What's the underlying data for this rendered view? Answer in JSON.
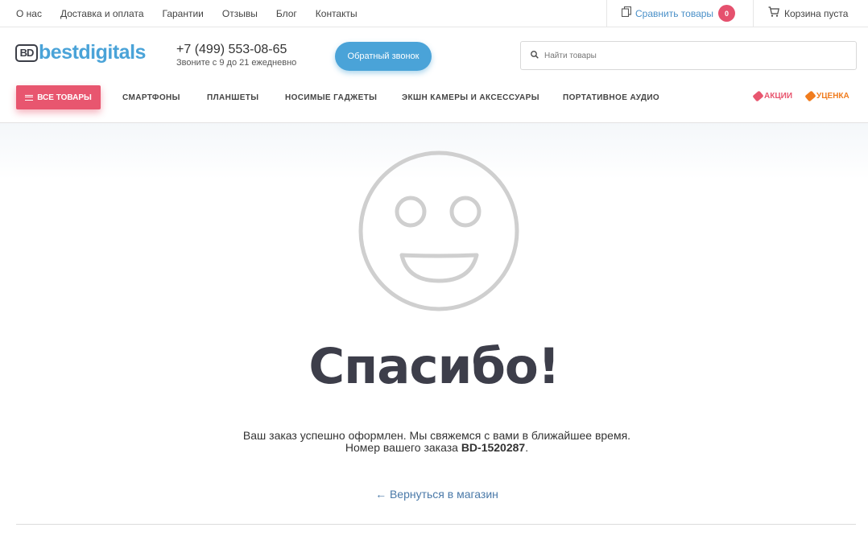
{
  "topbar": {
    "links": [
      "О нас",
      "Доставка и оплата",
      "Гарантии",
      "Отзывы",
      "Блог",
      "Контакты"
    ],
    "compare_label": "Сравнить товары",
    "compare_count": "0",
    "cart_label": "Корзина пуста"
  },
  "header": {
    "logo_mark": "BD",
    "logo_text": "bestdigitals",
    "phone": "+7 (499) 553-08-65",
    "hours": "Звоните с 9 до 21 ежедневно",
    "callback_label": "Обратный звонок",
    "search_placeholder": "Найти товары"
  },
  "nav": {
    "all_label": "ВСЕ ТОВАРЫ",
    "items": [
      "СМАРТФОНЫ",
      "ПЛАНШЕТЫ",
      "НОСИМЫЕ ГАДЖЕТЫ",
      "ЭКШН КАМЕРЫ И АКСЕССУАРЫ",
      "ПОРТАТИВНОЕ АУДИО"
    ],
    "promo_sales": "АКЦИИ",
    "promo_discount": "УЦЕНКА"
  },
  "main": {
    "title": "Спасибо!",
    "message": "Ваш заказ успешно оформлен. Мы свяжемся с вами в ближайшее время.",
    "order_prefix": "Номер вашего заказа",
    "order_number": "BD-1520287",
    "order_suffix": ".",
    "back_link": "← Вернуться в магазин"
  },
  "colors": {
    "accent_blue": "#4aa3d8",
    "accent_pink": "#e8566f",
    "promo_orange": "#f07c1e",
    "title_dark": "#3d3e4a"
  }
}
